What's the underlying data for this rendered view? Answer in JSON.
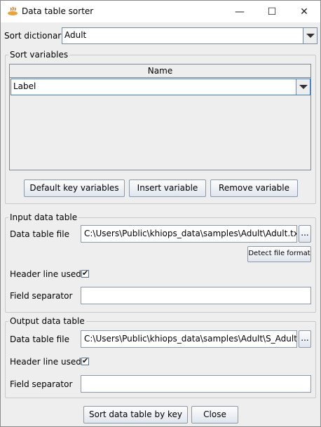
{
  "window": {
    "title": "Data table sorter",
    "controls": {
      "minimize": "—",
      "maximize": "☐",
      "close": "✕"
    }
  },
  "sort_dictionary": {
    "label": "Sort dictionary",
    "value": "Adult"
  },
  "sort_variables": {
    "legend": "Sort variables",
    "column_header": "Name",
    "rows": [
      "Label"
    ],
    "buttons": {
      "default_key": "Default key variables",
      "insert": "Insert variable",
      "remove": "Remove variable"
    }
  },
  "input_table": {
    "legend": "Input data table",
    "file_label": "Data table file",
    "file_value": "C:\\Users\\Public\\khiops_data\\samples\\Adult\\Adult.txt",
    "browse": "...",
    "detect_button": "Detect file format",
    "header_label": "Header line used",
    "header_checked": true,
    "separator_label": "Field separator",
    "separator_value": ""
  },
  "output_table": {
    "legend": "Output data table",
    "file_label": "Data table file",
    "file_value": "C:\\Users\\Public\\khiops_data\\samples\\Adult\\S_Adult.txt",
    "browse": "...",
    "header_label": "Header line used",
    "header_checked": true,
    "separator_label": "Field separator",
    "separator_value": ""
  },
  "footer": {
    "sort_button": "Sort data table by key",
    "close_button": "Close"
  }
}
